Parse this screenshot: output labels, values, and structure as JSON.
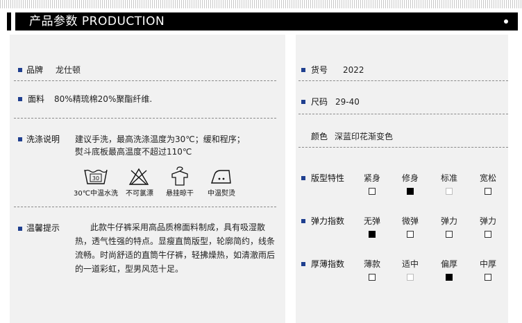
{
  "header": {
    "title": "产品参数  PRODUCTION"
  },
  "left": {
    "brand": {
      "label": "品牌",
      "value": "龙仕顿"
    },
    "fabric": {
      "label": "面料",
      "value": "80%精琉棉20%聚酯纤维."
    },
    "washing": {
      "label": "洗涤说明",
      "line1": "建议手洗，最高洗涤温度为30℃；缓和程序；",
      "line2": "熨斗底板最高温度不超过110℃",
      "icons": [
        {
          "name": "wash-30-icon",
          "text": "30",
          "label": "30℃中温水洗"
        },
        {
          "name": "no-bleach-icon",
          "text": "",
          "label": "不可氯漂"
        },
        {
          "name": "hang-dry-icon",
          "text": "",
          "label": "悬挂晾干"
        },
        {
          "name": "iron-medium-icon",
          "text": "",
          "label": "中温熨烫"
        }
      ]
    },
    "tips": {
      "label": "温馨提示",
      "text": "此款牛仔裤采用高品质棉面料制成，具有吸湿散热，透气性强的特点。显瘦直筒版型，轮廓简约，线条流畅。时尚舒适的直筒牛仔裤，轻拂燥热，如清澈雨后的一道彩虹，型男风范十足。"
    }
  },
  "right": {
    "item_no": {
      "label": "货号",
      "value": "2022"
    },
    "size": {
      "label": "尺码",
      "value": "29-40"
    },
    "color": {
      "label": "颜色",
      "value": "深蓝印花渐变色"
    },
    "fit": {
      "label": "版型特性",
      "options": [
        "紧身",
        "修身",
        "标准",
        "宽松"
      ],
      "selected": 1,
      "light": [
        2
      ]
    },
    "stretch": {
      "label": "弹力指数",
      "options": [
        "无弹",
        "微弹",
        "弹力",
        "弹力"
      ],
      "selected": 0,
      "light": []
    },
    "thickness": {
      "label": "厚薄指数",
      "options": [
        "薄款",
        "适中",
        "偏厚",
        "中厚"
      ],
      "selected": 2,
      "light": [
        1
      ]
    }
  }
}
